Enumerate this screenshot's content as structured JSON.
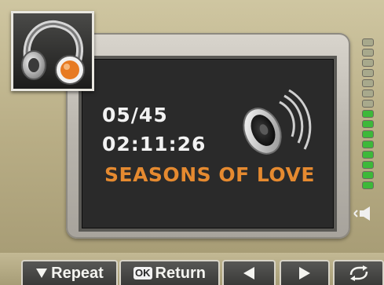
{
  "player": {
    "track_counter": "05/45",
    "elapsed_time": "02:11:26",
    "track_title": "SEASONS OF LOVE"
  },
  "volume": {
    "total_segments": 15,
    "active_segments": 8,
    "active_color": "#3db83a",
    "inactive_color": "#a8a98c"
  },
  "softkeys": {
    "repeat_label": "Repeat",
    "ok_label": "OK",
    "return_label": "Return"
  },
  "icons": {
    "corner": "headphones-icon",
    "screen": "speaker-sound-icon",
    "volume": "volume-speaker-icon",
    "prev": "triangle-left-icon",
    "next": "triangle-right-icon",
    "repeat_mode": "repeat-cycle-icon",
    "down": "triangle-down-icon"
  },
  "colors": {
    "title_orange": "#e58a30",
    "screen_bg": "#2a2a2a",
    "text_white": "#f2f2f2"
  }
}
